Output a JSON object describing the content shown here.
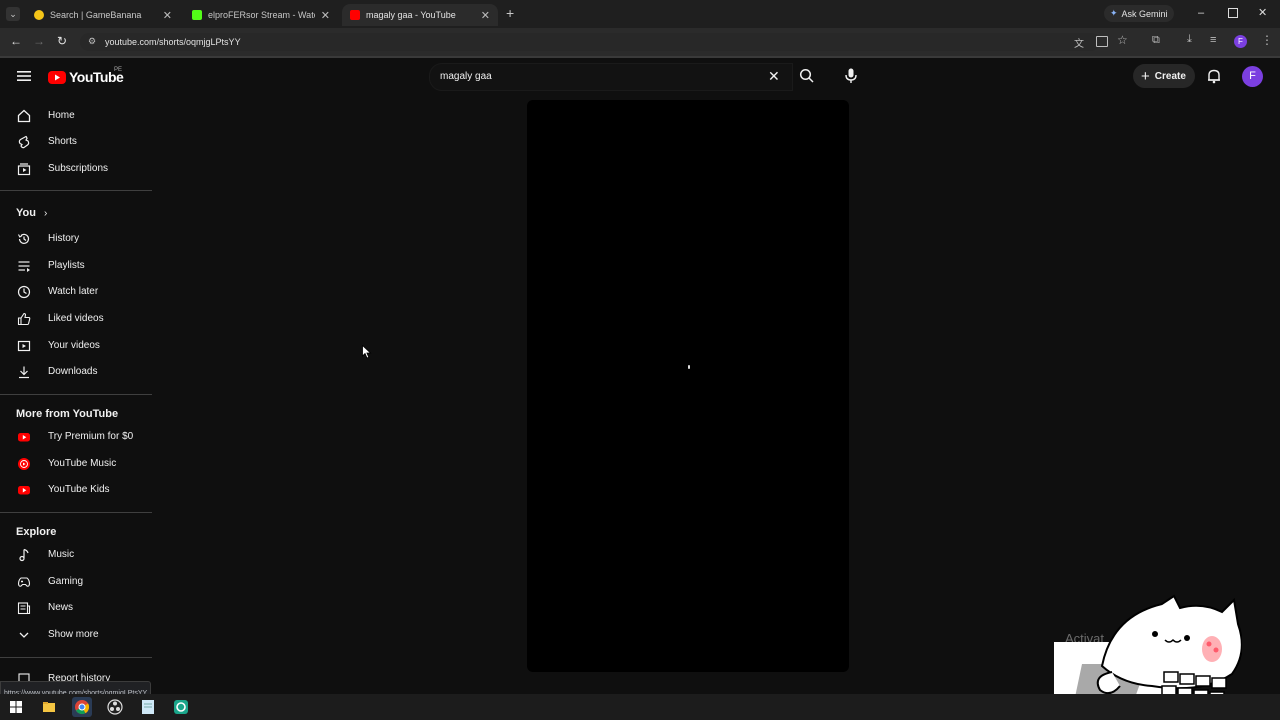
{
  "browser": {
    "tabs": [
      {
        "title": "Search | GameBanana",
        "favicon_color": "#f5c518"
      },
      {
        "title": "elproFERsor Stream - Watch Li",
        "favicon_color": "#53fc18"
      },
      {
        "title": "magaly gaa - YouTube",
        "favicon_color": "#ff0000"
      }
    ],
    "new_tab": "+",
    "ask_gemini": "Ask Gemini",
    "url": "youtube.com/shorts/oqmjgLPtsYY",
    "status_url": "https://www.youtube.com/shorts/oqmjgLPtsYY",
    "profile_initial": "F"
  },
  "youtube": {
    "logo_text": "YouTube",
    "country_code": "PE",
    "search_value": "magaly gaa",
    "create_label": "Create",
    "avatar_initial": "F",
    "sidebar": {
      "main": [
        {
          "label": "Home",
          "icon": "home-icon"
        },
        {
          "label": "Shorts",
          "icon": "shorts-icon"
        },
        {
          "label": "Subscriptions",
          "icon": "subscriptions-icon"
        }
      ],
      "you_title": "You",
      "you": [
        {
          "label": "History",
          "icon": "history-icon"
        },
        {
          "label": "Playlists",
          "icon": "playlists-icon"
        },
        {
          "label": "Watch later",
          "icon": "watch-later-icon"
        },
        {
          "label": "Liked videos",
          "icon": "like-icon"
        },
        {
          "label": "Your videos",
          "icon": "your-videos-icon"
        },
        {
          "label": "Downloads",
          "icon": "download-icon"
        }
      ],
      "more_title": "More from YouTube",
      "more": [
        {
          "label": "Try Premium for $0",
          "icon": "youtube-premium-icon"
        },
        {
          "label": "YouTube Music",
          "icon": "youtube-music-icon"
        },
        {
          "label": "YouTube Kids",
          "icon": "youtube-kids-icon"
        }
      ],
      "explore_title": "Explore",
      "explore": [
        {
          "label": "Music",
          "icon": "music-note-icon"
        },
        {
          "label": "Gaming",
          "icon": "gaming-icon"
        },
        {
          "label": "News",
          "icon": "news-icon"
        },
        {
          "label": "Show more",
          "icon": "chevron-down-icon"
        }
      ],
      "report_history": "Report history"
    }
  },
  "overlay": {
    "activate_text": "Activat"
  },
  "colors": {
    "youtube_red": "#ff0000",
    "avatar": "#7b3fe0",
    "background": "#0f0f0f"
  }
}
